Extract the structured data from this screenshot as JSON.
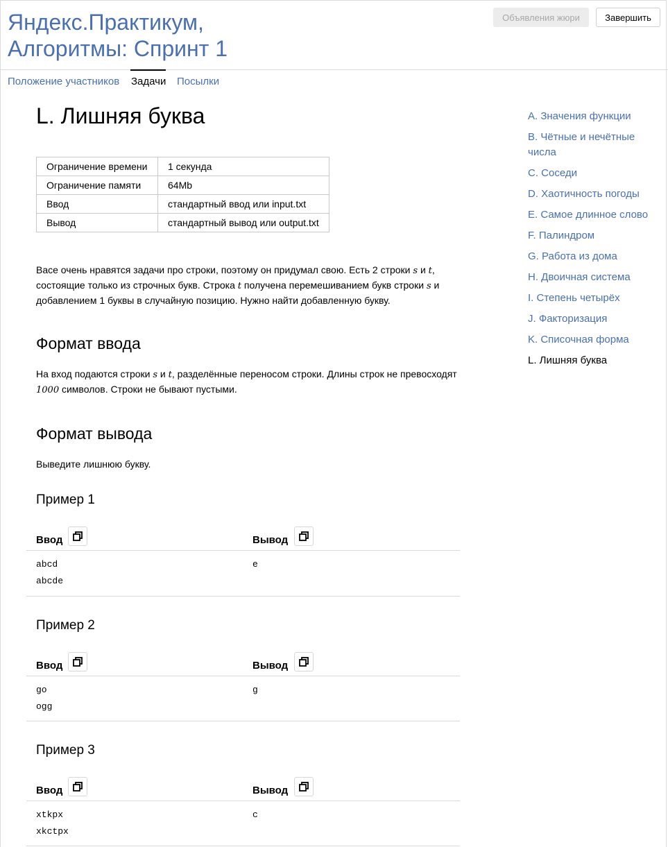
{
  "header": {
    "title_line1": "Яндекс.Практикум,",
    "title_line2": "Алгоритмы: Спринт 1",
    "jury_button": "Объявления жюри",
    "finish_button": "Завершить"
  },
  "nav": {
    "tabs": [
      {
        "label": "Положение участников"
      },
      {
        "label": "Задачи"
      },
      {
        "label": "Посылки"
      }
    ],
    "active": "Задачи"
  },
  "problem": {
    "title": "L. Лишняя буква",
    "limits": [
      {
        "key": "Ограничение времени",
        "value": "1 секунда"
      },
      {
        "key": "Ограничение памяти",
        "value": "64Mb"
      },
      {
        "key": "Ввод",
        "value": "стандартный ввод или input.txt"
      },
      {
        "key": "Вывод",
        "value": "стандартный вывод или output.txt"
      }
    ],
    "statement": {
      "p1": "Васе очень нравятся задачи про строки, поэтому он придумал свою. Есть 2 строки ",
      "v1": "s",
      "p2": " и ",
      "v2": "t",
      "p3": ", состоящие только из строчных букв. Строка ",
      "v3": "t",
      "p4": " получена перемешиванием букв строки ",
      "v4": "s",
      "p5": " и добавлением 1 буквы в случайную позицию. Нужно найти добавленную букву."
    },
    "input_format_heading": "Формат ввода",
    "input_format": {
      "p1": "На вход подаются строки ",
      "v1": "s",
      "p2": " и ",
      "v2": "t",
      "p3": ", разделённые переносом строки. Длины строк не превосходят ",
      "v3": "1000",
      "p4": " символов. Строки не бывают пустыми."
    },
    "output_format_heading": "Формат вывода",
    "output_format": "Выведите лишнюю букву.",
    "input_label": "Ввод",
    "output_label": "Вывод",
    "examples": [
      {
        "title": "Пример 1",
        "input": [
          "abcd",
          "abcde"
        ],
        "output": "e"
      },
      {
        "title": "Пример 2",
        "input": [
          "go",
          "ogg"
        ],
        "output": "g"
      },
      {
        "title": "Пример 3",
        "input": [
          "xtkpx",
          "xkctpx"
        ],
        "output": "c"
      }
    ]
  },
  "sidebar": {
    "items": [
      {
        "label": "A. Значения функции"
      },
      {
        "label": "B. Чётные и нечётные числа"
      },
      {
        "label": "C. Соседи"
      },
      {
        "label": "D. Хаотичность погоды"
      },
      {
        "label": "E. Самое длинное слово"
      },
      {
        "label": "F. Палиндром"
      },
      {
        "label": "G. Работа из дома"
      },
      {
        "label": "H. Двоичная система"
      },
      {
        "label": "I. Степень четырёх"
      },
      {
        "label": "J. Факторизация"
      },
      {
        "label": "K. Списочная форма"
      },
      {
        "label": "L. Лишняя буква"
      }
    ],
    "current": "L. Лишняя буква"
  },
  "colors": {
    "link": "#4a6fb3",
    "border": "#d9d9d9"
  },
  "icons": {
    "copy": "copy-icon"
  }
}
